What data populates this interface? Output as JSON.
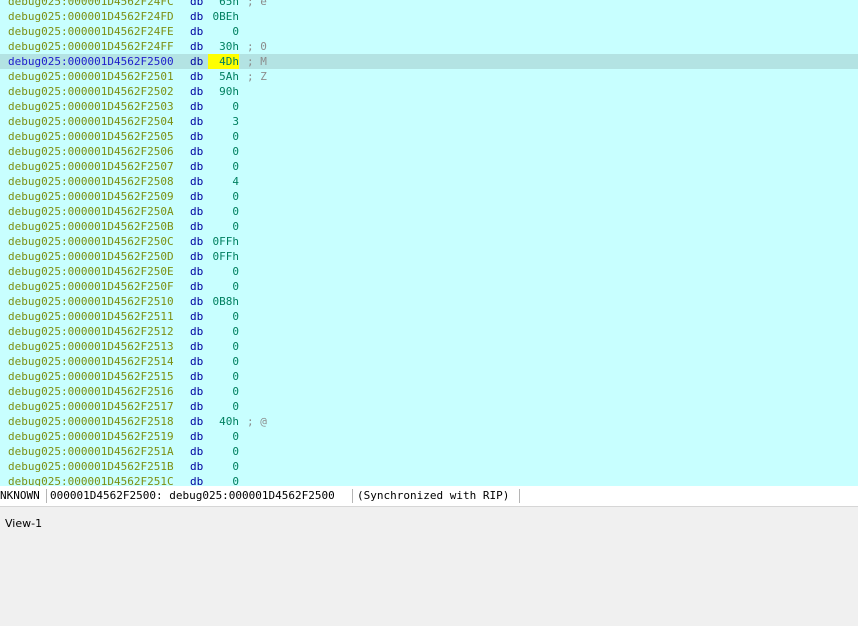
{
  "listing": {
    "rows": [
      {
        "address": "debug025:000001D4562F24FC",
        "mnemonic": "db",
        "operand": "65h",
        "comment": "; e"
      },
      {
        "address": "debug025:000001D4562F24FD",
        "mnemonic": "db",
        "operand": "0BEh",
        "comment": ""
      },
      {
        "address": "debug025:000001D4562F24FE",
        "mnemonic": "db",
        "operand": "0",
        "comment": ""
      },
      {
        "address": "debug025:000001D4562F24FF",
        "mnemonic": "db",
        "operand": "30h",
        "comment": "; 0"
      },
      {
        "address": "debug025:000001D4562F2500",
        "mnemonic": "db",
        "operand": "4Dh",
        "comment": "; M",
        "current": true
      },
      {
        "address": "debug025:000001D4562F2501",
        "mnemonic": "db",
        "operand": "5Ah",
        "comment": "; Z"
      },
      {
        "address": "debug025:000001D4562F2502",
        "mnemonic": "db",
        "operand": "90h",
        "comment": ""
      },
      {
        "address": "debug025:000001D4562F2503",
        "mnemonic": "db",
        "operand": "0",
        "comment": ""
      },
      {
        "address": "debug025:000001D4562F2504",
        "mnemonic": "db",
        "operand": "3",
        "comment": ""
      },
      {
        "address": "debug025:000001D4562F2505",
        "mnemonic": "db",
        "operand": "0",
        "comment": ""
      },
      {
        "address": "debug025:000001D4562F2506",
        "mnemonic": "db",
        "operand": "0",
        "comment": ""
      },
      {
        "address": "debug025:000001D4562F2507",
        "mnemonic": "db",
        "operand": "0",
        "comment": ""
      },
      {
        "address": "debug025:000001D4562F2508",
        "mnemonic": "db",
        "operand": "4",
        "comment": ""
      },
      {
        "address": "debug025:000001D4562F2509",
        "mnemonic": "db",
        "operand": "0",
        "comment": ""
      },
      {
        "address": "debug025:000001D4562F250A",
        "mnemonic": "db",
        "operand": "0",
        "comment": ""
      },
      {
        "address": "debug025:000001D4562F250B",
        "mnemonic": "db",
        "operand": "0",
        "comment": ""
      },
      {
        "address": "debug025:000001D4562F250C",
        "mnemonic": "db",
        "operand": "0FFh",
        "comment": ""
      },
      {
        "address": "debug025:000001D4562F250D",
        "mnemonic": "db",
        "operand": "0FFh",
        "comment": ""
      },
      {
        "address": "debug025:000001D4562F250E",
        "mnemonic": "db",
        "operand": "0",
        "comment": ""
      },
      {
        "address": "debug025:000001D4562F250F",
        "mnemonic": "db",
        "operand": "0",
        "comment": ""
      },
      {
        "address": "debug025:000001D4562F2510",
        "mnemonic": "db",
        "operand": "0B8h",
        "comment": ""
      },
      {
        "address": "debug025:000001D4562F2511",
        "mnemonic": "db",
        "operand": "0",
        "comment": ""
      },
      {
        "address": "debug025:000001D4562F2512",
        "mnemonic": "db",
        "operand": "0",
        "comment": ""
      },
      {
        "address": "debug025:000001D4562F2513",
        "mnemonic": "db",
        "operand": "0",
        "comment": ""
      },
      {
        "address": "debug025:000001D4562F2514",
        "mnemonic": "db",
        "operand": "0",
        "comment": ""
      },
      {
        "address": "debug025:000001D4562F2515",
        "mnemonic": "db",
        "operand": "0",
        "comment": ""
      },
      {
        "address": "debug025:000001D4562F2516",
        "mnemonic": "db",
        "operand": "0",
        "comment": ""
      },
      {
        "address": "debug025:000001D4562F2517",
        "mnemonic": "db",
        "operand": "0",
        "comment": ""
      },
      {
        "address": "debug025:000001D4562F2518",
        "mnemonic": "db",
        "operand": "40h",
        "comment": "; @"
      },
      {
        "address": "debug025:000001D4562F2519",
        "mnemonic": "db",
        "operand": "0",
        "comment": ""
      },
      {
        "address": "debug025:000001D4562F251A",
        "mnemonic": "db",
        "operand": "0",
        "comment": ""
      },
      {
        "address": "debug025:000001D4562F251B",
        "mnemonic": "db",
        "operand": "0",
        "comment": ""
      },
      {
        "address": "debug025:000001D4562F251C",
        "mnemonic": "db",
        "operand": "0",
        "comment": ""
      }
    ]
  },
  "statusbar": {
    "segment_type": "NKNOWN",
    "location": "000001D4562F2500: debug025:000001D4562F2500",
    "sync_status": "(Synchronized with RIP)"
  },
  "tabs": [
    {
      "label": "View-1"
    }
  ],
  "colors": {
    "listing_background": "#c8ffff",
    "current_line_background": "#b3e3e3",
    "address_color": "#7d8f12",
    "current_address_color": "#1d1dcc",
    "mnemonic_color": "#0000a0",
    "operand_color": "#008060",
    "operand_highlight": "#ffff00",
    "comment_color": "#8c8c8c"
  }
}
